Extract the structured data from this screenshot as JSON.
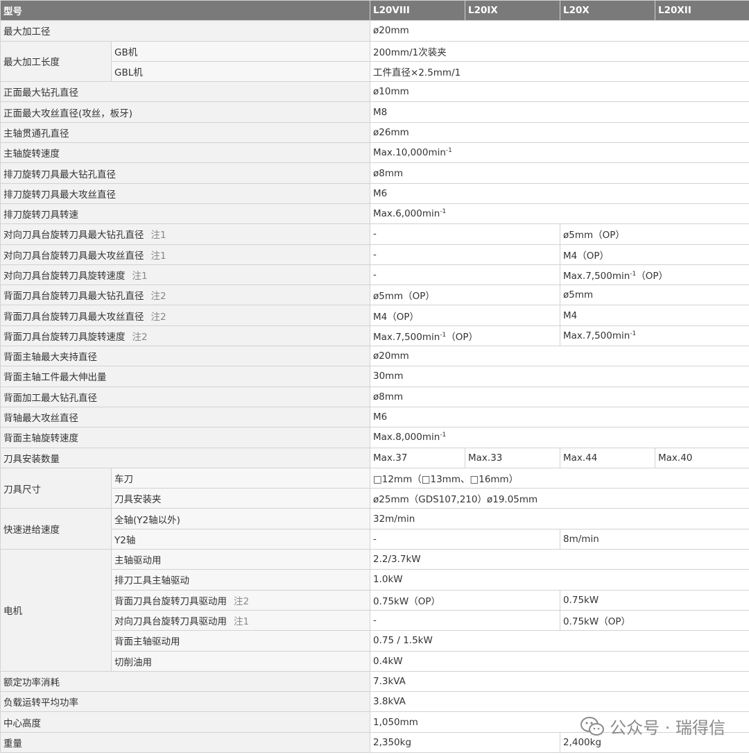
{
  "header": {
    "col0": "型号",
    "models": [
      "L20VIII",
      "L20IX",
      "L20X",
      "L20XII"
    ]
  },
  "rows": {
    "max_dia": {
      "label": "最大加工径",
      "value": "ø20mm"
    },
    "max_len": {
      "label": "最大加工长度",
      "gb_label": "GB机",
      "gb_value": "200mm/1次装夹",
      "gbl_label": "GBL机",
      "gbl_value": "工件直径×2.5mm/1"
    },
    "front_drill": {
      "label": "正面最大钻孔直径",
      "value": "ø10mm"
    },
    "front_tap": {
      "label": "正面最大攻丝直径(攻丝，板牙)",
      "value": "M8"
    },
    "spindle_bore": {
      "label": "主轴贯通孔直径",
      "value": "ø26mm"
    },
    "spindle_speed": {
      "label": "主轴旋转速度",
      "value": "Max.10,000min",
      "sup": "-1"
    },
    "gang_drill": {
      "label": "排刀旋转刀具最大钻孔直径",
      "value": "ø8mm"
    },
    "gang_tap": {
      "label": "排刀旋转刀具最大攻丝直径",
      "value": "M6"
    },
    "gang_speed": {
      "label": "排刀旋转刀具转速",
      "value": "Max.6,000min",
      "sup": "-1"
    },
    "opp_drill": {
      "label": "对向刀具台旋转刀具最大钻孔直径",
      "note": "注1",
      "value_a": "-",
      "value_b": "ø5mm（OP）"
    },
    "opp_tap": {
      "label": "对向刀具台旋转刀具最大攻丝直径",
      "note": "注1",
      "value_a": "-",
      "value_b": "M4（OP）"
    },
    "opp_speed": {
      "label": "对向刀具台旋转刀具旋转速度",
      "note": "注1",
      "value_a": "-",
      "value_b": "Max.7,500min",
      "value_b_sup": "-1",
      "value_b_suffix": "（OP）"
    },
    "back_drill": {
      "label": "背面刀具台旋转刀具最大钻孔直径",
      "note": "注2",
      "value_a": "ø5mm（OP）",
      "value_b": "ø5mm"
    },
    "back_tap": {
      "label": "背面刀具台旋转刀具最大攻丝直径",
      "note": "注2",
      "value_a": "M4（OP）",
      "value_b": "M4"
    },
    "back_speed": {
      "label": "背面刀具台旋转刀具旋转速度",
      "note": "注2",
      "value_a": "Max.7,500min",
      "value_a_sup": "-1",
      "value_a_suffix": "（OP）",
      "value_b": "Max.7,500min",
      "value_b_sup": "-1"
    },
    "sub_chuck": {
      "label": "背面主轴最大夹持直径",
      "value": "ø20mm"
    },
    "sub_protrude": {
      "label": "背面主轴工件最大伸出量",
      "value": "30mm"
    },
    "back_max_drill": {
      "label": "背面加工最大钻孔直径",
      "value": "ø8mm"
    },
    "back_axis_tap": {
      "label": "背轴最大攻丝直径",
      "value": "M6"
    },
    "sub_speed": {
      "label": "背面主轴旋转速度",
      "value": "Max.8,000min",
      "sup": "-1"
    },
    "tool_count": {
      "label": "刀具安装数量",
      "values": [
        "Max.37",
        "Max.33",
        "Max.44",
        "Max.40"
      ]
    },
    "tool_size": {
      "label": "刀具尺寸",
      "turn_label": "车刀",
      "turn_value": "□12mm（□13mm、□16mm）",
      "holder_label": "刀具安装夹",
      "holder_value": "ø25mm（GDS107,210）ø19.05mm"
    },
    "rapid": {
      "label": "快速进给速度",
      "all_label": "全轴(Y2轴以外)",
      "all_value": "32m/min",
      "y2_label": "Y2轴",
      "y2_value_a": "-",
      "y2_value_b": "8m/min"
    },
    "motor": {
      "label": "电机",
      "main_label": "主轴驱动用",
      "main_value": "2.2/3.7kW",
      "gang_label": "排刀工具主轴驱动",
      "gang_value": "1.0kW",
      "back_label": "背面刀具台旋转刀具驱动用",
      "back_note": "注2",
      "back_value_a": "0.75kW（OP）",
      "back_value_b": "0.75kW",
      "opp_label": "对向刀具台旋转刀具驱动用",
      "opp_note": "注1",
      "opp_value_a": "-",
      "opp_value_b": "0.75kW（OP）",
      "sub_label": "背面主轴驱动用",
      "sub_value": "0.75 / 1.5kW",
      "coolant_label": "切削油用",
      "coolant_value": "0.4kW"
    },
    "rated_power": {
      "label": "额定功率消耗",
      "value": "7.3kVA"
    },
    "avg_power": {
      "label": "负载运转平均功率",
      "value": "3.8kVA"
    },
    "center_height": {
      "label": "中心高度",
      "value": "1,050mm"
    },
    "weight": {
      "label": "重量",
      "value_a": "2,350kg",
      "value_b": "2,400kg"
    }
  },
  "watermark": {
    "text": "公众号 · 瑞得信",
    "icon": "wechat-icon"
  },
  "colors": {
    "header_bg": "#7a7a7a",
    "label_bg": "#f2f2f2",
    "border": "#d2d2d2"
  }
}
